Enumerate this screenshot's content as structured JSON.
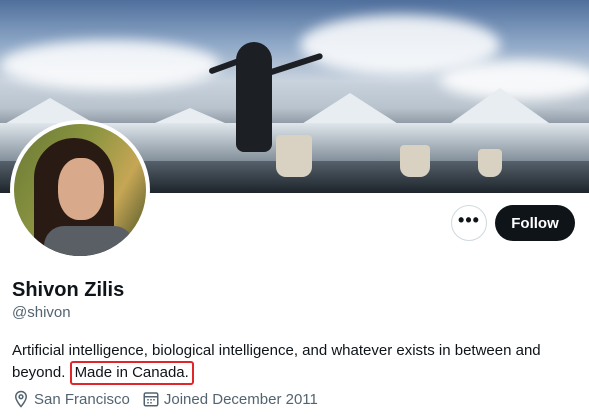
{
  "profile": {
    "name": "Shivon Zilis",
    "handle": "@shivon",
    "bio_main": "Artificial intelligence, biological intelligence, and whatever exists in between and beyond.",
    "bio_highlight": "Made in Canada.",
    "location": "San Francisco",
    "joined": "Joined December 2011"
  },
  "actions": {
    "more_label": "•••",
    "follow_label": "Follow"
  },
  "icons": {
    "location": "location-pin-icon",
    "calendar": "calendar-icon",
    "more": "more-dots-icon"
  },
  "colors": {
    "primary_text": "#0f1419",
    "secondary_text": "#536471",
    "follow_bg": "#0f1419",
    "highlight_border": "#e0262b"
  }
}
